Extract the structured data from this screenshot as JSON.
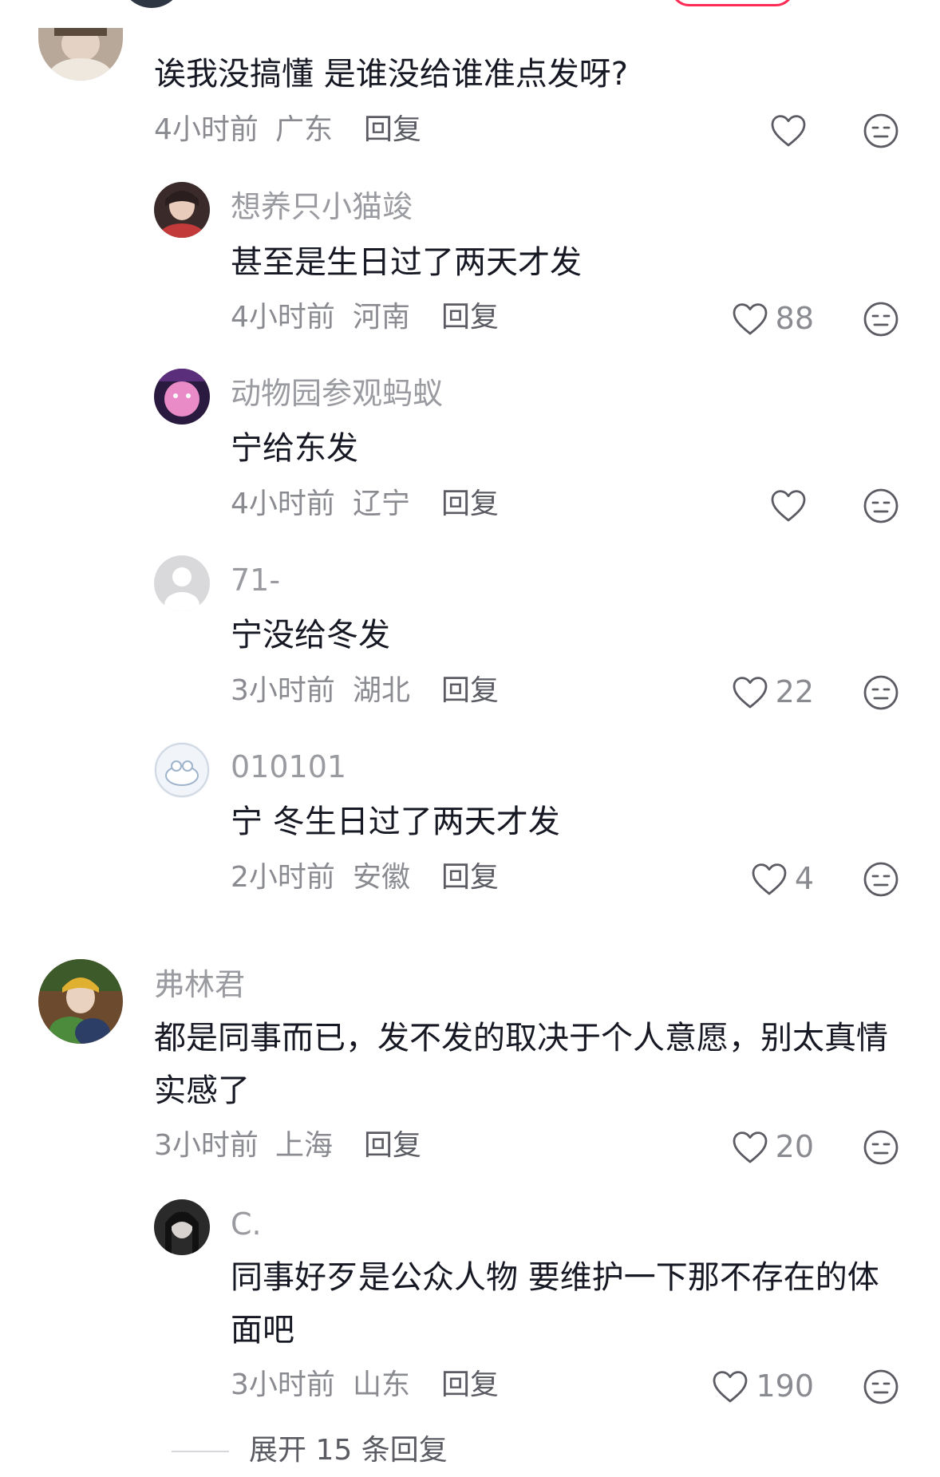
{
  "comments": [
    {
      "username": "",
      "text": "诶我没搞懂 是谁没给谁准点发呀?",
      "time": "4小时前",
      "location": "广东",
      "reply_label": "回复",
      "likes": "",
      "icons": {
        "like": "heart-outline-icon",
        "dislike": "dislike-face-icon"
      }
    },
    {
      "username": "想养只小猫竣",
      "text": "甚至是生日过了两天才发",
      "time": "4小时前",
      "location": "河南",
      "reply_label": "回复",
      "likes": "88"
    },
    {
      "username": "动物园参观蚂蚁",
      "text": "宁给东发",
      "time": "4小时前",
      "location": "辽宁",
      "reply_label": "回复",
      "likes": ""
    },
    {
      "username": "71-",
      "text": "宁没给冬发",
      "time": "3小时前",
      "location": "湖北",
      "reply_label": "回复",
      "likes": "22"
    },
    {
      "username": "010101",
      "text": "宁 冬生日过了两天才发",
      "time": "2小时前",
      "location": "安徽",
      "reply_label": "回复",
      "likes": "4"
    },
    {
      "username": "弗林君",
      "text": "都是同事而已，发不发的取决于个人意愿，别太真情实感了",
      "time": "3小时前",
      "location": "上海",
      "reply_label": "回复",
      "likes": "20"
    },
    {
      "username": "C.",
      "text": "同事好歹是公众人物 要维护一下那不存在的体面吧",
      "time": "3小时前",
      "location": "山东",
      "reply_label": "回复",
      "likes": "190"
    }
  ],
  "expand_replies": "展开 15 条回复",
  "colors": {
    "accent": "#fe2c55",
    "text": "#161823",
    "muted": "#8a8b91"
  }
}
